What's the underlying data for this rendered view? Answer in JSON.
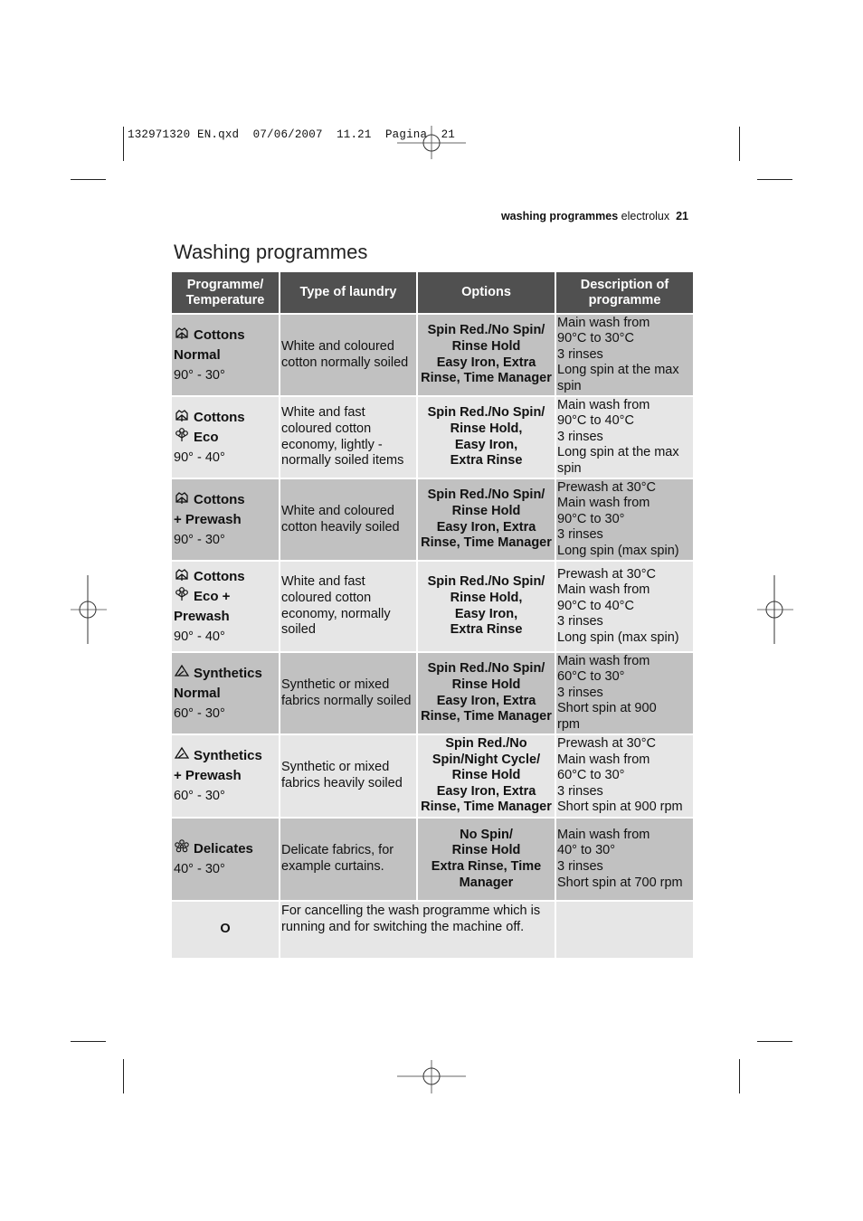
{
  "print_slug": {
    "filename": "132971320 EN.qxd",
    "date": "07/06/2007",
    "time": "11.21",
    "page_label": "Pagina",
    "page_number": "21"
  },
  "running_header": {
    "section": "washing programmes",
    "brand": "electrolux",
    "page": "21"
  },
  "page_title": "Washing programmes",
  "table": {
    "headers": [
      "Programme/ Temperature",
      "Type of laundry",
      "Options",
      "Description of programme"
    ],
    "rows": [
      {
        "shade": "dark",
        "programme_lines": [
          {
            "icon": "cotton-icon",
            "text": "Cottons"
          },
          {
            "icon": "",
            "text": "Normal"
          }
        ],
        "temperature": "90° - 30°",
        "laundry": "White and coloured cotton normally soiled",
        "options": [
          "Spin Red./No Spin/",
          "Rinse Hold",
          "Easy Iron, Extra",
          "Rinse, Time Manager"
        ],
        "description": [
          "Main wash from",
          "90°C to 30°C",
          "3 rinses",
          "Long spin at the max",
          "spin"
        ]
      },
      {
        "shade": "light",
        "programme_lines": [
          {
            "icon": "cotton-icon",
            "text": "Cottons"
          },
          {
            "icon": "eco-icon",
            "text": "Eco"
          }
        ],
        "temperature": "90° - 40°",
        "laundry": "White and fast coloured cotton economy, lightly - normally soiled items",
        "options": [
          "Spin Red./No Spin/",
          "Rinse Hold,",
          "Easy Iron,",
          "Extra Rinse"
        ],
        "description": [
          "Main wash from",
          "90°C to 40°C",
          "3 rinses",
          "Long spin at the max",
          "spin"
        ]
      },
      {
        "shade": "dark",
        "programme_lines": [
          {
            "icon": "cotton-icon",
            "text": "Cottons"
          },
          {
            "icon": "",
            "text": "+ Prewash"
          }
        ],
        "temperature": "90° - 30°",
        "laundry": "White and coloured cotton heavily soiled",
        "options": [
          "Spin Red./No Spin/",
          "Rinse Hold",
          "Easy Iron, Extra",
          "Rinse, Time Manager"
        ],
        "description": [
          "Prewash at 30°C",
          "Main wash from",
          "90°C to 30°",
          "3 rinses",
          "Long spin (max spin)"
        ]
      },
      {
        "shade": "light",
        "programme_lines": [
          {
            "icon": "cotton-icon",
            "text": "Cottons"
          },
          {
            "icon": "eco-icon",
            "text": "Eco +"
          },
          {
            "icon": "",
            "text": "Prewash"
          }
        ],
        "temperature": "90° - 40°",
        "laundry": "White and fast coloured cotton economy, normally soiled",
        "options": [
          "Spin Red./No Spin/",
          "Rinse Hold,",
          "Easy Iron,",
          "Extra Rinse"
        ],
        "description": [
          "Prewash at 30°C",
          "Main wash from",
          "90°C to 40°C",
          "3 rinses",
          "Long spin (max spin)"
        ]
      },
      {
        "shade": "dark",
        "programme_lines": [
          {
            "icon": "synthetics-icon",
            "text": "Synthetics"
          },
          {
            "icon": "",
            "text": "Normal"
          }
        ],
        "temperature": "60° - 30°",
        "laundry": "Synthetic or mixed fabrics normally soiled",
        "options": [
          "Spin Red./No Spin/",
          "Rinse Hold",
          "Easy Iron, Extra",
          "Rinse, Time Manager"
        ],
        "description": [
          "Main wash from",
          "60°C to 30°",
          "3 rinses",
          "Short spin at 900",
          "rpm"
        ]
      },
      {
        "shade": "light",
        "programme_lines": [
          {
            "icon": "synthetics-icon",
            "text": "Synthetics"
          },
          {
            "icon": "",
            "text": "+ Prewash"
          }
        ],
        "temperature": "60° - 30°",
        "laundry": "Synthetic or mixed fabrics heavily soiled",
        "options": [
          "Spin Red./No",
          "Spin/Night Cycle/",
          "Rinse Hold",
          "Easy Iron, Extra",
          "Rinse, Time Manager"
        ],
        "description": [
          "Prewash at 30°C",
          "Main wash from",
          "60°C to 30°",
          "3 rinses",
          "Short spin at 900 rpm"
        ]
      },
      {
        "shade": "dark",
        "programme_lines": [
          {
            "icon": "delicates-icon",
            "text": "Delicates"
          }
        ],
        "temperature": "40° - 30°",
        "laundry": "Delicate fabrics, for example curtains.",
        "options": [
          "No Spin/",
          "Rinse Hold",
          "Extra Rinse, Time",
          "Manager"
        ],
        "description": [
          "Main wash from",
          "40° to 30°",
          "3 rinses",
          "Short spin at 700 rpm"
        ]
      }
    ],
    "off_row": {
      "symbol": "O",
      "text": "For cancelling the wash programme which is running and for switching the machine off."
    }
  },
  "colors": {
    "header_bg": "#505050",
    "row_dark": "#c1c1c1",
    "row_light": "#e6e6e6"
  }
}
